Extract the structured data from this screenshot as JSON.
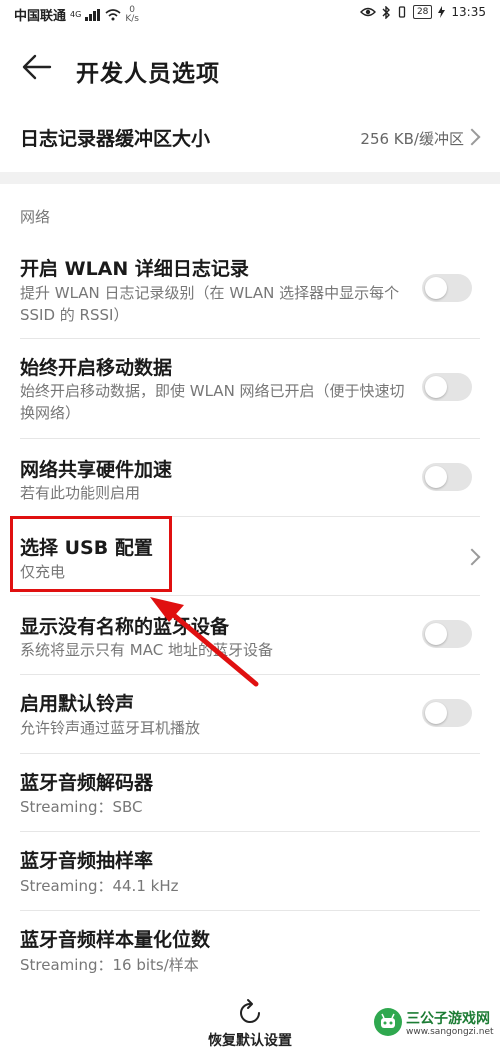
{
  "status_bar": {
    "carrier": "中国联通",
    "network_badge": "4G",
    "net_speed_value": "0",
    "net_speed_unit": "K/s",
    "battery": "28",
    "time": "13:35",
    "icons": [
      "signal-icon",
      "wifi-icon",
      "eye-icon",
      "bluetooth-icon",
      "vibrate-icon",
      "battery-icon",
      "charging-icon"
    ]
  },
  "header": {
    "title": "开发人员选项",
    "back_icon": "back-arrow-icon"
  },
  "buffer_row": {
    "title": "日志记录器缓冲区大小",
    "value": "256 KB/缓冲区"
  },
  "section": {
    "label": "网络"
  },
  "items": [
    {
      "title": "开启 WLAN 详细日志记录",
      "subtitle": "提升 WLAN 日志记录级别（在 WLAN 选择器中显示每个 SSID 的 RSSI）",
      "control": "toggle",
      "on": false
    },
    {
      "title": "始终开启移动数据",
      "subtitle": "始终开启移动数据，即使 WLAN 网络已开启（便于快速切换网络）",
      "control": "toggle",
      "on": false
    },
    {
      "title": "网络共享硬件加速",
      "subtitle": "若有此功能则启用",
      "control": "toggle",
      "on": false
    },
    {
      "title": "选择 USB 配置",
      "subtitle": "仅充电",
      "control": "chevron"
    },
    {
      "title": "显示没有名称的蓝牙设备",
      "subtitle": "系统将显示只有 MAC 地址的蓝牙设备",
      "control": "toggle",
      "on": false
    },
    {
      "title": "启用默认铃声",
      "subtitle": "允许铃声通过蓝牙耳机播放",
      "control": "toggle",
      "on": false
    },
    {
      "title": "蓝牙音频解码器",
      "subtitle": "Streaming：SBC",
      "control": "none"
    },
    {
      "title": "蓝牙音频抽样率",
      "subtitle": "Streaming：44.1 kHz",
      "control": "none"
    },
    {
      "title": "蓝牙音频样本量化位数",
      "subtitle": "Streaming：16 bits/样本",
      "control": "none"
    }
  ],
  "annotation": {
    "highlight_color": "#e01010"
  },
  "bottom_bar": {
    "reset_label": "恢复默认设置",
    "reset_icon": "reset-icon"
  },
  "watermark": {
    "name": "三公子游戏网",
    "url": "www.sangongzi.net"
  }
}
